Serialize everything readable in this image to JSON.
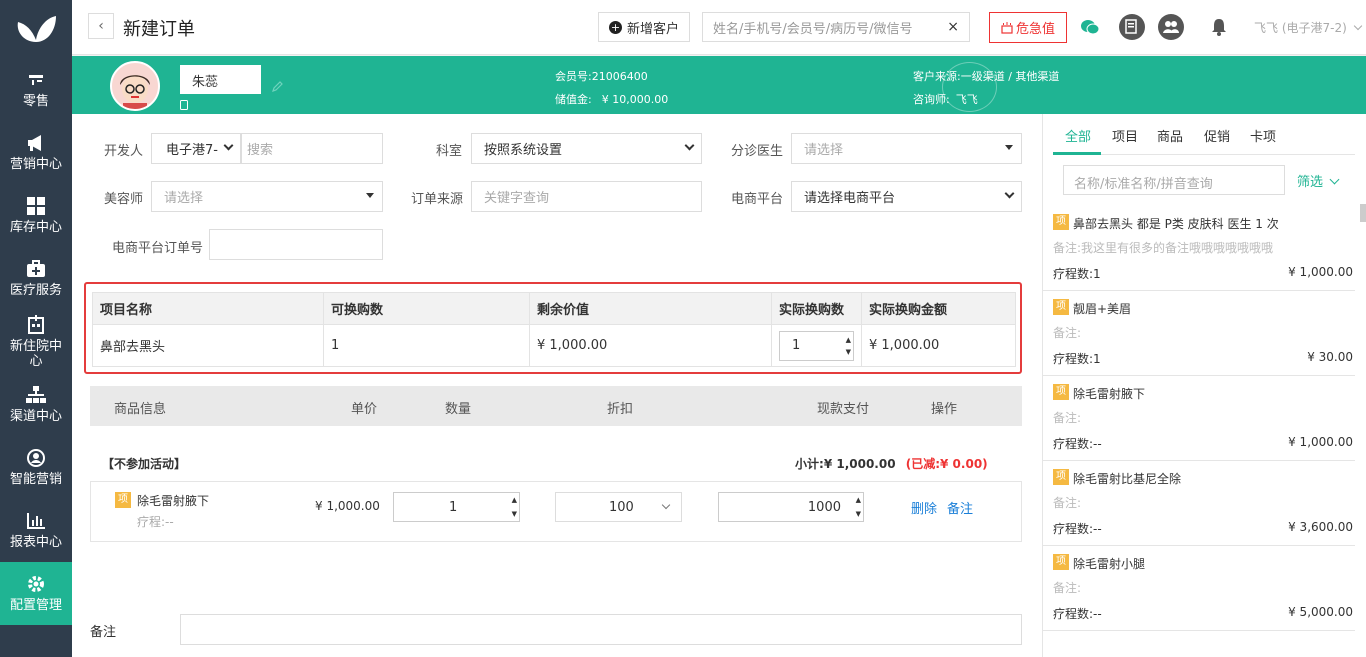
{
  "nav": {
    "items": [
      {
        "label": "零售",
        "icon": "cashier-icon"
      },
      {
        "label": "营销中心",
        "icon": "megaphone-icon"
      },
      {
        "label": "库存中心",
        "icon": "grid-icon"
      },
      {
        "label": "医疗服务",
        "icon": "medical-kit-icon"
      },
      {
        "label": "新住院中心",
        "icon": "hospital-icon"
      },
      {
        "label": "渠道中心",
        "icon": "org-chart-icon"
      },
      {
        "label": "智能营销",
        "icon": "smart-user-icon"
      },
      {
        "label": "报表中心",
        "icon": "bar-chart-icon"
      },
      {
        "label": "配置管理",
        "icon": "gear-icon"
      }
    ],
    "active_index": 8
  },
  "header": {
    "back": "‹",
    "title": "新建订单",
    "new_customer": "新增客户",
    "search_placeholder": "姓名/手机号/会员号/病历号/微信号",
    "clear": "×",
    "danger_button": "危急值",
    "user": "飞飞 (电子港7-2)"
  },
  "customer": {
    "name": "朱蕊",
    "member_label": "会员号:",
    "member_no": "21006400",
    "balance_label": "储值金:",
    "balance": "¥ 10,000.00",
    "source_label": "客户来源:",
    "source": "一级渠道 / 其他渠道",
    "consultant_label": "咨询师:",
    "consultant": "飞飞"
  },
  "form": {
    "developer_label": "开发人",
    "developer_value": "电子港7-",
    "developer_search": "搜索",
    "dept_label": "科室",
    "dept_value": "按照系统设置",
    "triage_label": "分诊医生",
    "triage_value": "请选择",
    "beautician_label": "美容师",
    "beautician_value": "请选择",
    "order_source_label": "订单来源",
    "order_source_value": "关键字查询",
    "ecom_label": "电商平台",
    "ecom_value": "请选择电商平台",
    "ecom_order_label": "电商平台订单号",
    "ecom_order_value": ""
  },
  "exchange_table": {
    "headers": [
      "项目名称",
      "可换购数",
      "剩余价值",
      "实际换购数",
      "实际换购金额"
    ],
    "row": {
      "name": "鼻部去黑头",
      "available": "1",
      "remaining": "¥ 1,000.00",
      "actual": "1",
      "amount": "¥ 1,000.00"
    }
  },
  "goods": {
    "headers": [
      "商品信息",
      "单价",
      "数量",
      "折扣",
      "现款支付",
      "操作"
    ],
    "activity": "【不参加活动】",
    "subtotal_label": "小计:",
    "subtotal": "¥ 1,000.00",
    "reduced": "(已减:¥ 0.00)",
    "item": {
      "tag": "项",
      "name": "除毛雷射腋下",
      "course": "疗程:--",
      "price": "¥ 1,000.00",
      "qty": "1",
      "discount": "100",
      "cash": "1000",
      "delete": "删除",
      "remark": "备注"
    },
    "remark_label": "备注"
  },
  "panel": {
    "tabs": [
      "全部",
      "项目",
      "商品",
      "促销",
      "卡项"
    ],
    "search_placeholder": "名称/标准名称/拼音查询",
    "filter": "筛选",
    "items": [
      {
        "tag": "项",
        "title": "鼻部去黑头   都是  P类  皮肤科  医生     1  次",
        "note": "备注:我这里有很多的备注哦哦哦哦哦哦哦",
        "course": "疗程数:1",
        "price": "¥ 1,000.00"
      },
      {
        "tag": "项",
        "title": "靓眉+美眉",
        "note": "备注:",
        "course": "疗程数:1",
        "price": "¥ 30.00"
      },
      {
        "tag": "项",
        "title": "除毛雷射腋下",
        "note": "备注:",
        "course": "疗程数:--",
        "price": "¥ 1,000.00"
      },
      {
        "tag": "项",
        "title": "除毛雷射比基尼全除",
        "note": "备注:",
        "course": "疗程数:--",
        "price": "¥ 3,600.00"
      },
      {
        "tag": "项",
        "title": "除毛雷射小腿",
        "note": "备注:",
        "course": "疗程数:--",
        "price": "¥ 5,000.00"
      }
    ]
  },
  "colors": {
    "sidebar": "#2f3d4c",
    "accent": "#1fb493",
    "danger": "#e33333",
    "link": "#1a7fd8"
  }
}
